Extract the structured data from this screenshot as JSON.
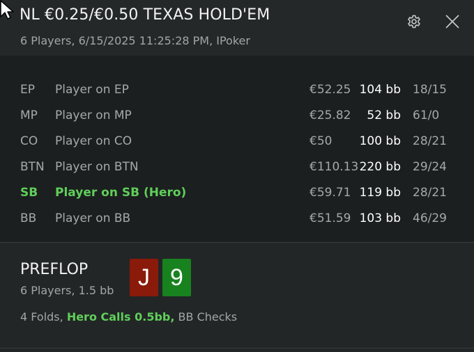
{
  "header": {
    "title": "NL €0.25/€0.50 TEXAS HOLD'EM",
    "subtitle": "6 Players, 6/15/2025 11:25:28 PM, IPoker",
    "icons": {
      "settings": "gear-icon",
      "close": "close-icon",
      "cursor": "mouse-pointer-icon"
    }
  },
  "players": [
    {
      "pos": "EP",
      "name": "Player on EP",
      "stack": "€52.25",
      "bb": "104 bb",
      "stat": "18/15"
    },
    {
      "pos": "MP",
      "name": "Player on MP",
      "stack": "€25.82",
      "bb": "52 bb",
      "stat": "61/0"
    },
    {
      "pos": "CO",
      "name": "Player on CO",
      "stack": "€50",
      "bb": "100 bb",
      "stat": "28/21"
    },
    {
      "pos": "BTN",
      "name": "Player on BTN",
      "stack": "€110.13",
      "bb": "220 bb",
      "stat": "29/24"
    },
    {
      "pos": "SB",
      "name": "Player on SB (Hero)",
      "stack": "€59.71",
      "bb": "119 bb",
      "stat": "28/21"
    },
    {
      "pos": "BB",
      "name": "Player on BB",
      "stack": "€51.59",
      "bb": "103 bb",
      "stat": "46/29"
    }
  ],
  "preflop": {
    "street": "PREFLOP",
    "info": "6 Players, 1.5 bb",
    "cards": [
      {
        "rank": "J",
        "color": "#8a1a0a"
      },
      {
        "rank": "9",
        "color": "#18821e"
      }
    ],
    "actions": {
      "folds": "4 Folds,",
      "hero": "Hero Calls 0.5bb,",
      "bb": "BB Checks"
    }
  },
  "colors": {
    "hero": "#5fcf5a",
    "background": "#1c1f1f",
    "header": "#252829"
  }
}
